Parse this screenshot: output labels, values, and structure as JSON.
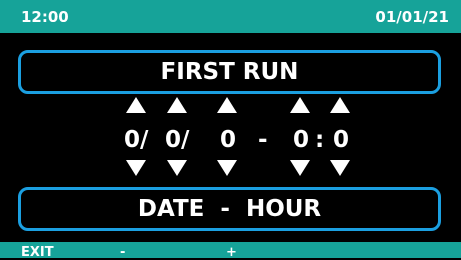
{
  "status": {
    "time": "12:00",
    "date": "01/01/21"
  },
  "title": "FIRST RUN",
  "fields": [
    {
      "name": "day",
      "value": "0/"
    },
    {
      "name": "month",
      "value": "0/"
    },
    {
      "name": "year",
      "value": "0"
    },
    {
      "name": "hour",
      "value": "0"
    },
    {
      "name": "minute",
      "value": "0"
    }
  ],
  "separators": {
    "date_time": "-",
    "time": ":"
  },
  "subtitle": "DATE  -  HOUR",
  "footer": {
    "exit": "EXIT",
    "minus": "-",
    "plus": "+"
  },
  "colors": {
    "accent": "#16a399",
    "border": "#1b9fe0",
    "background": "#000000",
    "text": "#ffffff"
  }
}
